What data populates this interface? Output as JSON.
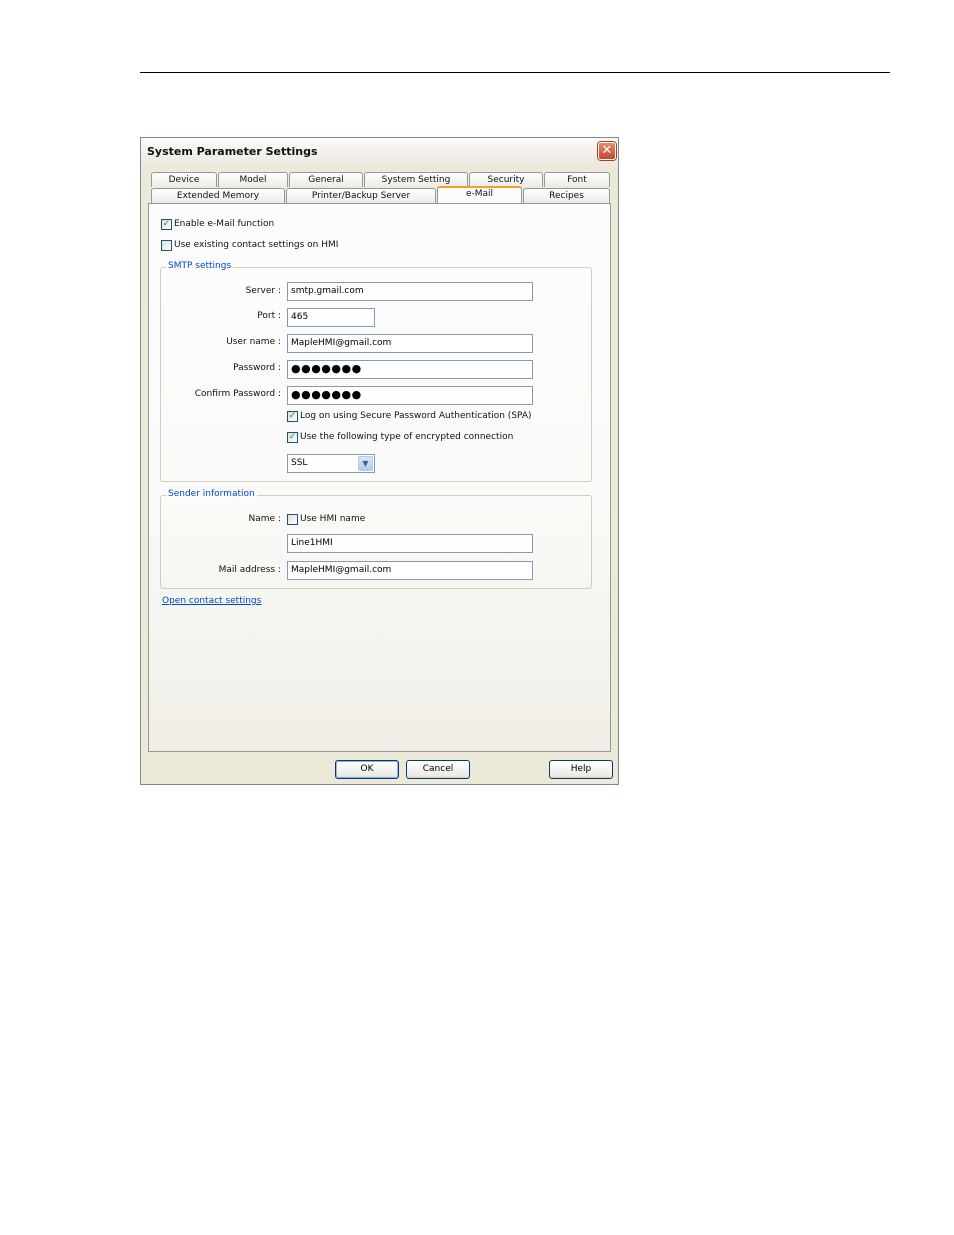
{
  "dialog": {
    "title": "System Parameter Settings",
    "close_icon": "close-icon"
  },
  "tabs_row1": [
    "Device",
    "Model",
    "General",
    "System Setting",
    "Security",
    "Font"
  ],
  "tabs_row2": [
    "Extended Memory",
    "Printer/Backup Server",
    "e-Mail",
    "Recipes"
  ],
  "active_tab": "e-Mail",
  "options": {
    "enable_email": {
      "label": "Enable e-Mail function",
      "checked": true
    },
    "use_existing_contacts": {
      "label": "Use existing contact settings on HMI",
      "checked": false
    }
  },
  "smtp": {
    "title": "SMTP settings",
    "server_label": "Server :",
    "server_value": "smtp.gmail.com",
    "port_label": "Port :",
    "port_value": "465",
    "username_label": "User name :",
    "username_value": "MapleHMI@gmail.com",
    "password_label": "Password :",
    "password_value": "●●●●●●●",
    "confirm_label": "Confirm Password :",
    "confirm_value": "●●●●●●●",
    "spa": {
      "label": "Log on using Secure Password Authentication (SPA)",
      "checked": true
    },
    "encrypted": {
      "label": "Use the following type of encrypted connection",
      "checked": true
    },
    "encryption_type": "SSL"
  },
  "sender": {
    "title": "Sender information",
    "name_label": "Name :",
    "use_hmi_name": {
      "label": "Use HMI name",
      "checked": false
    },
    "name_value": "Line1HMI",
    "mail_label": "Mail address :",
    "mail_value": "MapleHMI@gmail.com"
  },
  "contact_link": "Open contact settings",
  "buttons": {
    "ok": "OK",
    "cancel": "Cancel",
    "help": "Help"
  },
  "colors": {
    "accent_tab": "#f0a030",
    "group_title": "#0046d5",
    "check": "#21a121"
  }
}
